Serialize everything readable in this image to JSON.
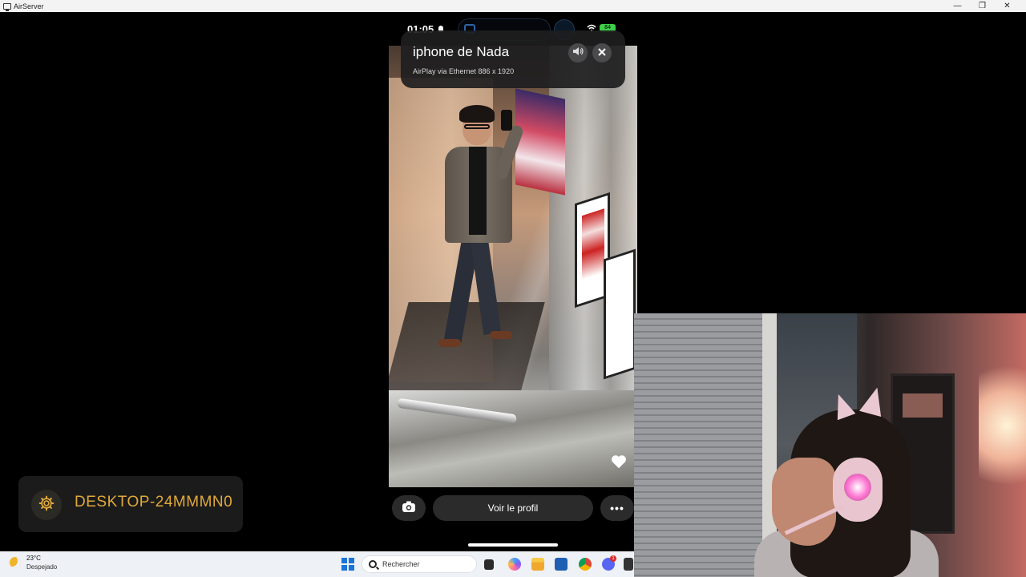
{
  "window": {
    "title": "AirServer",
    "minimize": "—",
    "restore": "❐",
    "close": "✕"
  },
  "phone_status": {
    "time": "01:05",
    "battery": "84"
  },
  "airplay_card": {
    "device_name": "iphone de Nada",
    "subtitle": "AirPlay via Ethernet 886 x 1920"
  },
  "phone_controls": {
    "profile_button": "Voir le profil",
    "more_button": "•••"
  },
  "desktop_card": {
    "name": "DESKTOP-24MMMN0"
  },
  "taskbar": {
    "temperature": "23°C",
    "condition": "Despejado",
    "search_placeholder": "Rechercher",
    "discord_badge": "1"
  },
  "colors": {
    "desktop_name": "#e0a93a",
    "battery": "#3ecf4a",
    "windows_blue": "#1a73d9"
  }
}
